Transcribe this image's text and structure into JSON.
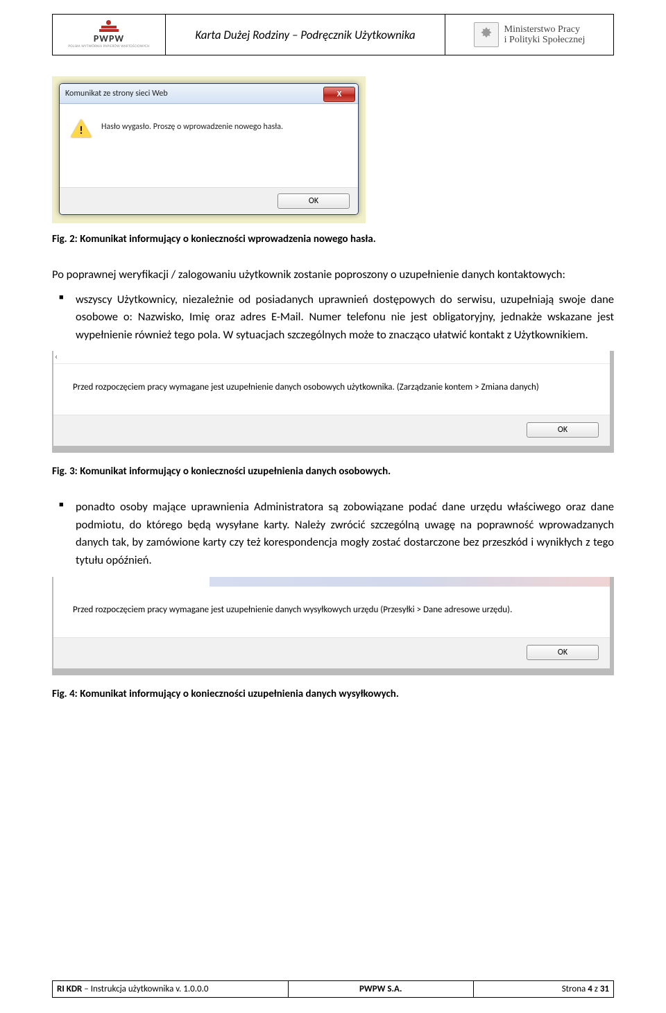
{
  "header": {
    "title": "Karta Dużej Rodziny – Podręcznik Użytkownika",
    "left_logo_main": "PWPW",
    "left_logo_sub": "POLSKA WYTWÓRNIA PAPIERÓW WARTOŚCIOWYCH",
    "right_line1": "Ministerstwo Pracy",
    "right_line2": "i Polityki Społecznej"
  },
  "dialog1": {
    "title": "Komunikat ze strony sieci Web",
    "message": "Hasło wygasło. Proszę o wprowadzenie nowego hasła.",
    "ok": "OK",
    "close_label": "X"
  },
  "captions": {
    "fig2": "Fig. 2: Komunikat informujący o konieczności wprowadzenia nowego hasła.",
    "fig3": "Fig. 3: Komunikat informujący o konieczności uzupełnienia danych osobowych.",
    "fig4": "Fig. 4: Komunikat informujący o konieczności uzupełnienia danych wysyłkowych."
  },
  "body": {
    "para1": "Po poprawnej weryfikacji / zalogowaniu użytkownik zostanie poproszony o uzupełnienie danych kontaktowych:",
    "bullet1": "wszyscy Użytkownicy, niezależnie od posiadanych uprawnień dostępowych do serwisu, uzupełniają swoje dane osobowe o: Nazwisko, Imię oraz adres E-Mail. Numer telefonu nie jest obligatoryjny, jednakże wskazane jest wypełnienie również tego pola. W sytuacjach szczególnych może to znacząco ułatwić kontakt z Użytkownikiem.",
    "bullet2": "ponadto osoby mające uprawnienia Administratora są zobowiązane podać dane urzędu właściwego oraz dane podmiotu, do którego będą wysyłane karty. Należy zwrócić szczególną uwagę na poprawność wprowadzanych danych tak, by zamówione karty czy też korespondencja mogły zostać dostarczone bez przeszkód i wynikłych z tego tytułu opóźnień."
  },
  "dialog2": {
    "message": "Przed rozpoczęciem pracy wymagane jest uzupełnienie danych osobowych użytkownika. (Zarządzanie kontem > Zmiana danych)",
    "ok": "OK"
  },
  "dialog3": {
    "message": "Przed rozpoczęciem pracy wymagane jest uzupełnienie danych wysyłkowych urzędu (Przesyłki > Dane adresowe urzędu).",
    "ok": "OK"
  },
  "footer": {
    "left_bold": "RI KDR",
    "left_rest": " – Instrukcja użytkownika v. 1.0.0.0",
    "center": "PWPW S.A.",
    "right_prefix": "Strona ",
    "right_page": "4",
    "right_sep": " z ",
    "right_total": "31"
  }
}
